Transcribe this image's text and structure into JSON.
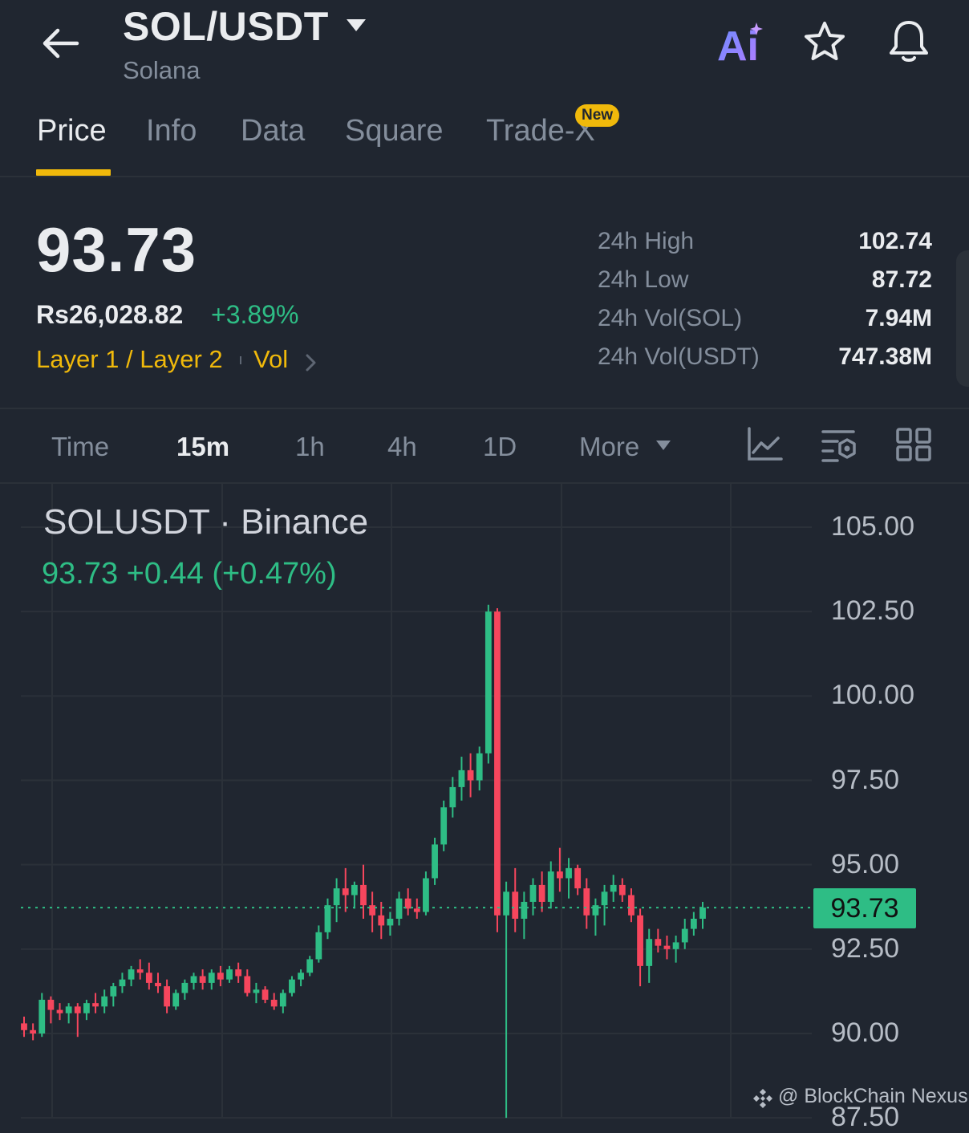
{
  "header": {
    "pair": "SOL/USDT",
    "name": "Solana",
    "ai_label": "Ai"
  },
  "tabs": [
    {
      "label": "Price",
      "active": true
    },
    {
      "label": "Info"
    },
    {
      "label": "Data"
    },
    {
      "label": "Square"
    },
    {
      "label": "Trade-X",
      "badge": "New"
    }
  ],
  "price": {
    "last": "93.73",
    "fiat": "Rs26,028.82",
    "change": "+3.89%",
    "tags": "Layer 1 / Layer 2",
    "vol_tag": "Vol"
  },
  "stats": [
    {
      "label": "24h High",
      "value": "102.74"
    },
    {
      "label": "24h Low",
      "value": "87.72"
    },
    {
      "label": "24h Vol(SOL)",
      "value": "7.94M"
    },
    {
      "label": "24h Vol(USDT)",
      "value": "747.38M"
    }
  ],
  "intervals": [
    {
      "label": "Time"
    },
    {
      "label": "15m",
      "active": true
    },
    {
      "label": "1h"
    },
    {
      "label": "4h"
    },
    {
      "label": "1D"
    },
    {
      "label": "More"
    }
  ],
  "tools": [
    "line-chart-icon",
    "indicator-settings-icon",
    "grid-layout-icon"
  ],
  "chart_data": {
    "type": "candlestick",
    "title": "SOLUSDT · Binance",
    "quote": "93.73  +0.44 (+0.47%)",
    "last_price": "93.73",
    "ylim": [
      87.0,
      106.0
    ],
    "y_ticks": [
      "105.00",
      "102.50",
      "100.00",
      "97.50",
      "95.00",
      "92.50",
      "90.00",
      "87.50"
    ],
    "y_tick_values": [
      105,
      102.5,
      100,
      97.5,
      95,
      92.5,
      90,
      87.5
    ],
    "colors": {
      "up": "#2ebd85",
      "down": "#f6465d",
      "grid": "#2b3139",
      "last_line": "#2ebd85"
    },
    "candles": [
      [
        90.3,
        90.5,
        89.9,
        90.1
      ],
      [
        90.1,
        90.3,
        89.8,
        90.0
      ],
      [
        90.0,
        91.2,
        89.9,
        91.0
      ],
      [
        91.0,
        91.1,
        90.3,
        90.7
      ],
      [
        90.7,
        90.9,
        90.4,
        90.6
      ],
      [
        90.6,
        90.9,
        90.3,
        90.8
      ],
      [
        90.8,
        90.9,
        89.9,
        90.6
      ],
      [
        90.6,
        91.0,
        90.4,
        90.9
      ],
      [
        90.9,
        91.2,
        90.6,
        90.8
      ],
      [
        90.8,
        91.3,
        90.6,
        91.1
      ],
      [
        91.1,
        91.5,
        90.8,
        91.4
      ],
      [
        91.4,
        91.8,
        91.2,
        91.6
      ],
      [
        91.6,
        92.0,
        91.4,
        91.9
      ],
      [
        91.9,
        92.2,
        91.6,
        91.8
      ],
      [
        91.8,
        92.1,
        91.3,
        91.5
      ],
      [
        91.5,
        91.8,
        91.2,
        91.4
      ],
      [
        91.4,
        91.6,
        90.6,
        90.8
      ],
      [
        90.8,
        91.3,
        90.7,
        91.2
      ],
      [
        91.2,
        91.6,
        91.0,
        91.5
      ],
      [
        91.5,
        91.8,
        91.3,
        91.7
      ],
      [
        91.7,
        91.9,
        91.3,
        91.5
      ],
      [
        91.5,
        91.9,
        91.3,
        91.8
      ],
      [
        91.8,
        92.0,
        91.4,
        91.6
      ],
      [
        91.6,
        92.0,
        91.5,
        91.9
      ],
      [
        91.9,
        92.1,
        91.5,
        91.7
      ],
      [
        91.7,
        91.9,
        91.1,
        91.2
      ],
      [
        91.2,
        91.5,
        90.9,
        91.3
      ],
      [
        91.3,
        91.4,
        90.9,
        91.0
      ],
      [
        91.0,
        91.2,
        90.7,
        90.8
      ],
      [
        90.8,
        91.3,
        90.6,
        91.2
      ],
      [
        91.2,
        91.7,
        91.1,
        91.6
      ],
      [
        91.6,
        91.9,
        91.4,
        91.8
      ],
      [
        91.8,
        92.3,
        91.7,
        92.2
      ],
      [
        92.2,
        93.2,
        92.1,
        93.0
      ],
      [
        93.0,
        94.0,
        92.8,
        93.8
      ],
      [
        93.8,
        94.6,
        93.3,
        94.3
      ],
      [
        94.3,
        94.9,
        93.6,
        94.1
      ],
      [
        94.1,
        94.5,
        93.7,
        94.4
      ],
      [
        94.4,
        95.0,
        93.4,
        93.8
      ],
      [
        93.8,
        94.2,
        93.0,
        93.5
      ],
      [
        93.5,
        93.9,
        92.8,
        93.2
      ],
      [
        93.2,
        93.6,
        92.9,
        93.4
      ],
      [
        93.4,
        94.2,
        93.2,
        94.0
      ],
      [
        94.0,
        94.3,
        93.5,
        93.7
      ],
      [
        93.7,
        94.0,
        93.4,
        93.6
      ],
      [
        93.6,
        94.8,
        93.5,
        94.6
      ],
      [
        94.6,
        95.8,
        94.4,
        95.6
      ],
      [
        95.6,
        96.9,
        95.4,
        96.7
      ],
      [
        96.7,
        97.6,
        96.4,
        97.3
      ],
      [
        97.3,
        98.2,
        96.9,
        97.8
      ],
      [
        97.8,
        98.3,
        97.0,
        97.5
      ],
      [
        97.5,
        98.5,
        97.2,
        98.3
      ],
      [
        98.3,
        102.7,
        98.0,
        102.5
      ],
      [
        102.5,
        102.6,
        93.0,
        93.5
      ],
      [
        93.5,
        94.5,
        87.5,
        94.2
      ],
      [
        94.2,
        94.9,
        93.0,
        93.4
      ],
      [
        93.4,
        94.2,
        92.8,
        93.9
      ],
      [
        93.9,
        94.6,
        93.5,
        94.4
      ],
      [
        94.4,
        94.8,
        93.6,
        93.9
      ],
      [
        93.9,
        95.1,
        93.7,
        94.8
      ],
      [
        94.8,
        95.5,
        94.2,
        94.6
      ],
      [
        94.6,
        95.2,
        94.0,
        94.9
      ],
      [
        94.9,
        95.0,
        94.1,
        94.3
      ],
      [
        94.3,
        94.6,
        93.1,
        93.5
      ],
      [
        93.5,
        94.0,
        92.9,
        93.8
      ],
      [
        93.8,
        94.4,
        93.2,
        94.2
      ],
      [
        94.2,
        94.7,
        93.9,
        94.4
      ],
      [
        94.4,
        94.6,
        93.9,
        94.1
      ],
      [
        94.1,
        94.3,
        93.3,
        93.5
      ],
      [
        93.5,
        93.7,
        91.4,
        92.0
      ],
      [
        92.0,
        93.1,
        91.5,
        92.8
      ],
      [
        92.8,
        93.1,
        92.4,
        92.6
      ],
      [
        92.6,
        92.9,
        92.2,
        92.5
      ],
      [
        92.5,
        92.9,
        92.1,
        92.7
      ],
      [
        92.7,
        93.4,
        92.5,
        93.1
      ],
      [
        93.1,
        93.6,
        92.9,
        93.4
      ],
      [
        93.4,
        93.9,
        93.1,
        93.73
      ]
    ]
  },
  "watermark": "@ BlockChain Nexus"
}
